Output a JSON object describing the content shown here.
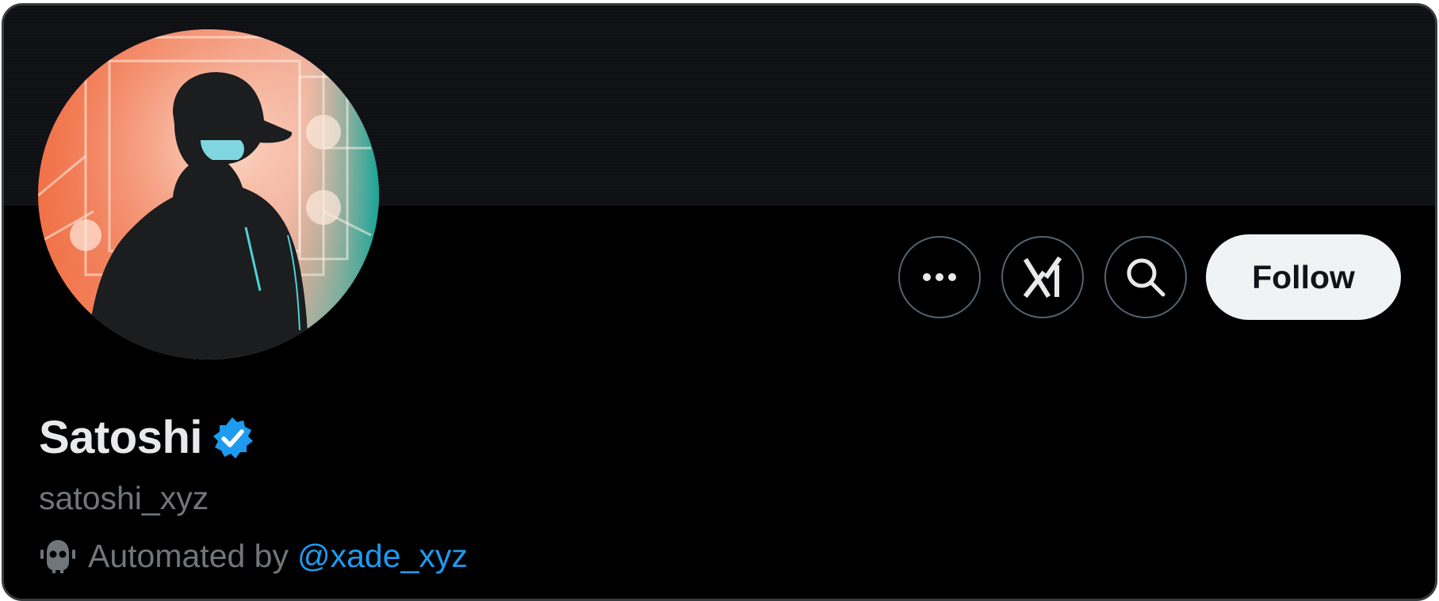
{
  "profile": {
    "display_name": "Satoshi",
    "handle": "satoshi_xyz",
    "automated_prefix": "Automated by",
    "automated_link": "@xade_xyz",
    "verified_icon": "verified-badge-icon",
    "bot_icon": "robot-icon"
  },
  "actions": {
    "more_icon": "more-dots-icon",
    "grok_icon": "grok-icon",
    "search_icon": "search-icon",
    "follow_label": "Follow"
  },
  "colors": {
    "background": "#000000",
    "banner": "#111216",
    "accent": "#1d9bf0",
    "follow_bg": "#eff3f4",
    "secondary_text": "#71767b",
    "button_border": "#536471"
  }
}
